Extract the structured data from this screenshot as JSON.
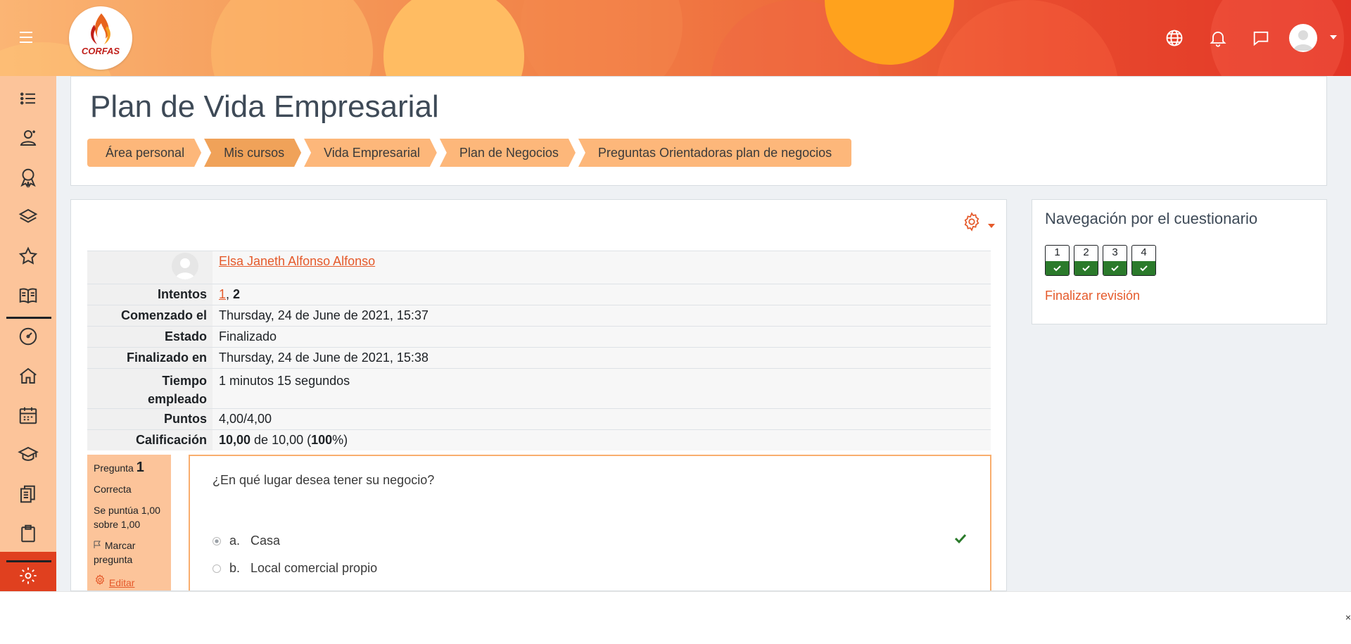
{
  "header": {
    "logo_text": "CORFAS",
    "menu_icon": "hamburger-icon",
    "icons": [
      "globe-icon",
      "bell-icon",
      "chat-icon",
      "user-avatar-icon"
    ],
    "colors": {
      "accent": "#e55a2b",
      "sidebar": "#fcc49a",
      "breadcrumb": "#fdb77a",
      "success": "#2b7a2b"
    }
  },
  "sidebar": {
    "items": [
      "list-icon",
      "users-icon",
      "badge-icon",
      "layers-icon",
      "star-icon",
      "book-icon",
      "dashboard-icon",
      "home-icon",
      "calendar-icon",
      "graduation-cap-icon",
      "files-icon",
      "clipboard-icon",
      "gear-icon"
    ]
  },
  "page": {
    "title": "Plan de Vida Empresarial",
    "breadcrumbs": [
      "Área personal",
      "Mis cursos",
      "Vida Empresarial",
      "Plan de Negocios",
      "Preguntas Orientadoras plan de negocios"
    ]
  },
  "summary": {
    "user_name": "Elsa Janeth Alfonso Alfonso",
    "rows": {
      "attempts_label": "Intentos",
      "attempt_link": "1",
      "attempt_sep": ", ",
      "attempt_current": "2",
      "started_label": "Comenzado el",
      "started_value": "Thursday, 24 de June de 2021, 15:37",
      "state_label": "Estado",
      "state_value": "Finalizado",
      "finished_label": "Finalizado en",
      "finished_value": "Thursday, 24 de June de 2021, 15:38",
      "time_label_1": "Tiempo",
      "time_label_2": "empleado",
      "time_value": "1 minutos 15 segundos",
      "points_label": "Puntos",
      "points_value": "4,00/4,00",
      "grade_label": "Calificación",
      "grade_bold": "10,00",
      "grade_mid": " de 10,00 (",
      "grade_pct": "100",
      "grade_end": "%)"
    }
  },
  "question": {
    "label": "Pregunta",
    "number": "1",
    "state": "Correcta",
    "mark_text": "Se puntúa 1,00 sobre 1,00",
    "flag_text": "Marcar pregunta",
    "edit_text": "Editar",
    "text": "¿En qué lugar desea tener su negocio?",
    "options": [
      {
        "letter": "a.",
        "text": "Casa",
        "checked": true,
        "correct": true
      },
      {
        "letter": "b.",
        "text": "Local comercial propio",
        "checked": false
      }
    ]
  },
  "quiz_nav": {
    "title": "Navegación por el cuestionario",
    "questions": [
      "1",
      "2",
      "3",
      "4"
    ],
    "finish": "Finalizar revisión"
  },
  "bottom": {
    "close": "×"
  }
}
